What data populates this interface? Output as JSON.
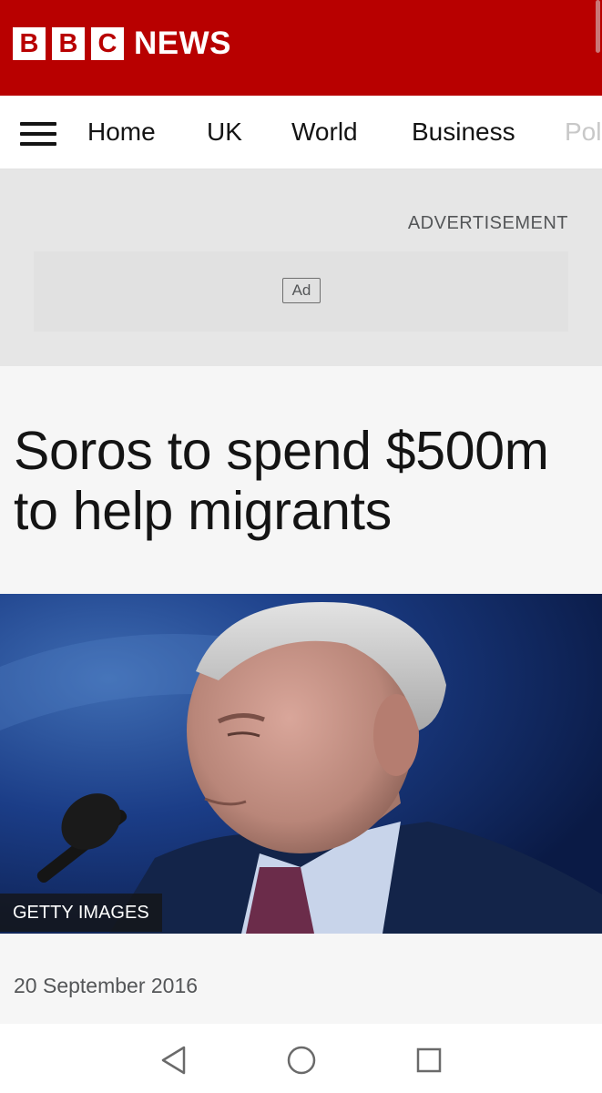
{
  "header": {
    "logo_letters": [
      "B",
      "B",
      "C"
    ],
    "logo_word": "NEWS",
    "brand_color": "#b80000"
  },
  "nav": {
    "menu_icon": "hamburger-menu-icon",
    "items": [
      {
        "label": "Home"
      },
      {
        "label": "UK"
      },
      {
        "label": "World"
      },
      {
        "label": "Business"
      },
      {
        "label": "Pol"
      }
    ]
  },
  "ad": {
    "label": "ADVERTISEMENT",
    "badge": "Ad"
  },
  "article": {
    "headline": "Soros to spend $500m to help migrants",
    "image_credit": "GETTY IMAGES",
    "date": "20 September 2016"
  },
  "system_nav": {
    "back_icon": "back-triangle-icon",
    "home_icon": "home-circle-icon",
    "recents_icon": "recents-square-icon"
  }
}
